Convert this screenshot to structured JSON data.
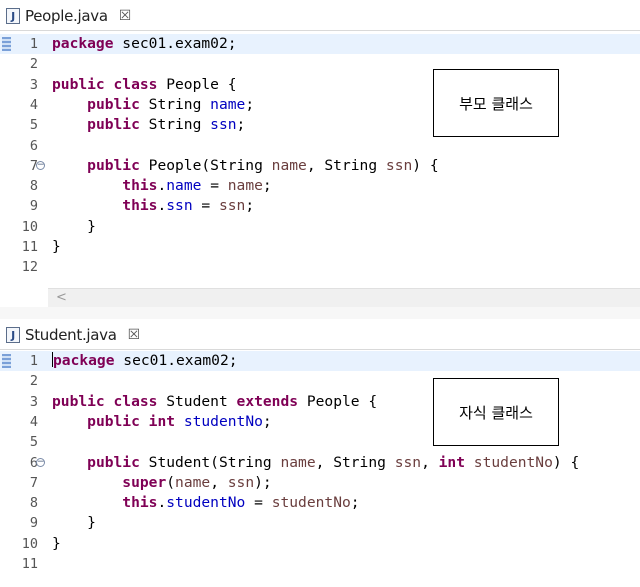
{
  "pane1": {
    "tab_label": "People.java",
    "tab_close": "☒",
    "annotation": "부모 클래스",
    "lines": [
      {
        "n": "1",
        "tokens": [
          {
            "t": "package",
            "c": "kw"
          },
          {
            "t": " sec01.exam02;"
          }
        ]
      },
      {
        "n": "2",
        "tokens": []
      },
      {
        "n": "3",
        "tokens": [
          {
            "t": "public",
            "c": "kw"
          },
          {
            "t": " "
          },
          {
            "t": "class",
            "c": "kw"
          },
          {
            "t": " People {"
          }
        ]
      },
      {
        "n": "4",
        "tokens": [
          {
            "t": "    "
          },
          {
            "t": "public",
            "c": "kw"
          },
          {
            "t": " String "
          },
          {
            "t": "name",
            "c": "fld"
          },
          {
            "t": ";"
          }
        ]
      },
      {
        "n": "5",
        "tokens": [
          {
            "t": "    "
          },
          {
            "t": "public",
            "c": "kw"
          },
          {
            "t": " String "
          },
          {
            "t": "ssn",
            "c": "fld"
          },
          {
            "t": ";"
          }
        ]
      },
      {
        "n": "6",
        "tokens": []
      },
      {
        "n": "7",
        "tokens": [
          {
            "t": "    "
          },
          {
            "t": "public",
            "c": "kw"
          },
          {
            "t": " People(String "
          },
          {
            "t": "name",
            "c": "par"
          },
          {
            "t": ", String "
          },
          {
            "t": "ssn",
            "c": "par"
          },
          {
            "t": ") {"
          }
        ]
      },
      {
        "n": "8",
        "tokens": [
          {
            "t": "        "
          },
          {
            "t": "this",
            "c": "kw"
          },
          {
            "t": "."
          },
          {
            "t": "name",
            "c": "fld"
          },
          {
            "t": " = "
          },
          {
            "t": "name",
            "c": "par"
          },
          {
            "t": ";"
          }
        ]
      },
      {
        "n": "9",
        "tokens": [
          {
            "t": "        "
          },
          {
            "t": "this",
            "c": "kw"
          },
          {
            "t": "."
          },
          {
            "t": "ssn",
            "c": "fld"
          },
          {
            "t": " = "
          },
          {
            "t": "ssn",
            "c": "par"
          },
          {
            "t": ";"
          }
        ]
      },
      {
        "n": "10",
        "tokens": [
          {
            "t": "    }"
          }
        ]
      },
      {
        "n": "11",
        "tokens": [
          {
            "t": "}"
          }
        ]
      },
      {
        "n": "12",
        "tokens": []
      }
    ],
    "fold_line": "7",
    "current_line": "1",
    "scroll_left_glyph": "<"
  },
  "pane2": {
    "tab_label": "Student.java",
    "tab_close": "☒",
    "annotation": "자식 클래스",
    "lines": [
      {
        "n": "1",
        "tokens": [
          {
            "t": "package",
            "c": "kw"
          },
          {
            "t": " sec01.exam02;"
          }
        ],
        "caret": true
      },
      {
        "n": "2",
        "tokens": []
      },
      {
        "n": "3",
        "tokens": [
          {
            "t": "public",
            "c": "kw"
          },
          {
            "t": " "
          },
          {
            "t": "class",
            "c": "kw"
          },
          {
            "t": " Student "
          },
          {
            "t": "extends",
            "c": "kw"
          },
          {
            "t": " People {"
          }
        ]
      },
      {
        "n": "4",
        "tokens": [
          {
            "t": "    "
          },
          {
            "t": "public",
            "c": "kw"
          },
          {
            "t": " "
          },
          {
            "t": "int",
            "c": "kw"
          },
          {
            "t": " "
          },
          {
            "t": "studentNo",
            "c": "fld"
          },
          {
            "t": ";"
          }
        ]
      },
      {
        "n": "5",
        "tokens": []
      },
      {
        "n": "6",
        "tokens": [
          {
            "t": "    "
          },
          {
            "t": "public",
            "c": "kw"
          },
          {
            "t": " Student(String "
          },
          {
            "t": "name",
            "c": "par"
          },
          {
            "t": ", String "
          },
          {
            "t": "ssn",
            "c": "par"
          },
          {
            "t": ", "
          },
          {
            "t": "int",
            "c": "kw"
          },
          {
            "t": " "
          },
          {
            "t": "studentNo",
            "c": "par"
          },
          {
            "t": ") {"
          }
        ]
      },
      {
        "n": "7",
        "tokens": [
          {
            "t": "        "
          },
          {
            "t": "super",
            "c": "kw"
          },
          {
            "t": "("
          },
          {
            "t": "name",
            "c": "par"
          },
          {
            "t": ", "
          },
          {
            "t": "ssn",
            "c": "par"
          },
          {
            "t": ");"
          }
        ]
      },
      {
        "n": "8",
        "tokens": [
          {
            "t": "        "
          },
          {
            "t": "this",
            "c": "kw"
          },
          {
            "t": "."
          },
          {
            "t": "studentNo",
            "c": "fld"
          },
          {
            "t": " = "
          },
          {
            "t": "studentNo",
            "c": "par"
          },
          {
            "t": ";"
          }
        ]
      },
      {
        "n": "9",
        "tokens": [
          {
            "t": "    }"
          }
        ]
      },
      {
        "n": "10",
        "tokens": [
          {
            "t": "}"
          }
        ]
      },
      {
        "n": "11",
        "tokens": []
      }
    ],
    "fold_line": "6",
    "current_line": "1"
  },
  "colors": {
    "keyword": "#7f0055",
    "field": "#0000c0",
    "param": "#6a3e3e",
    "current_line": "#e8f2fe"
  }
}
